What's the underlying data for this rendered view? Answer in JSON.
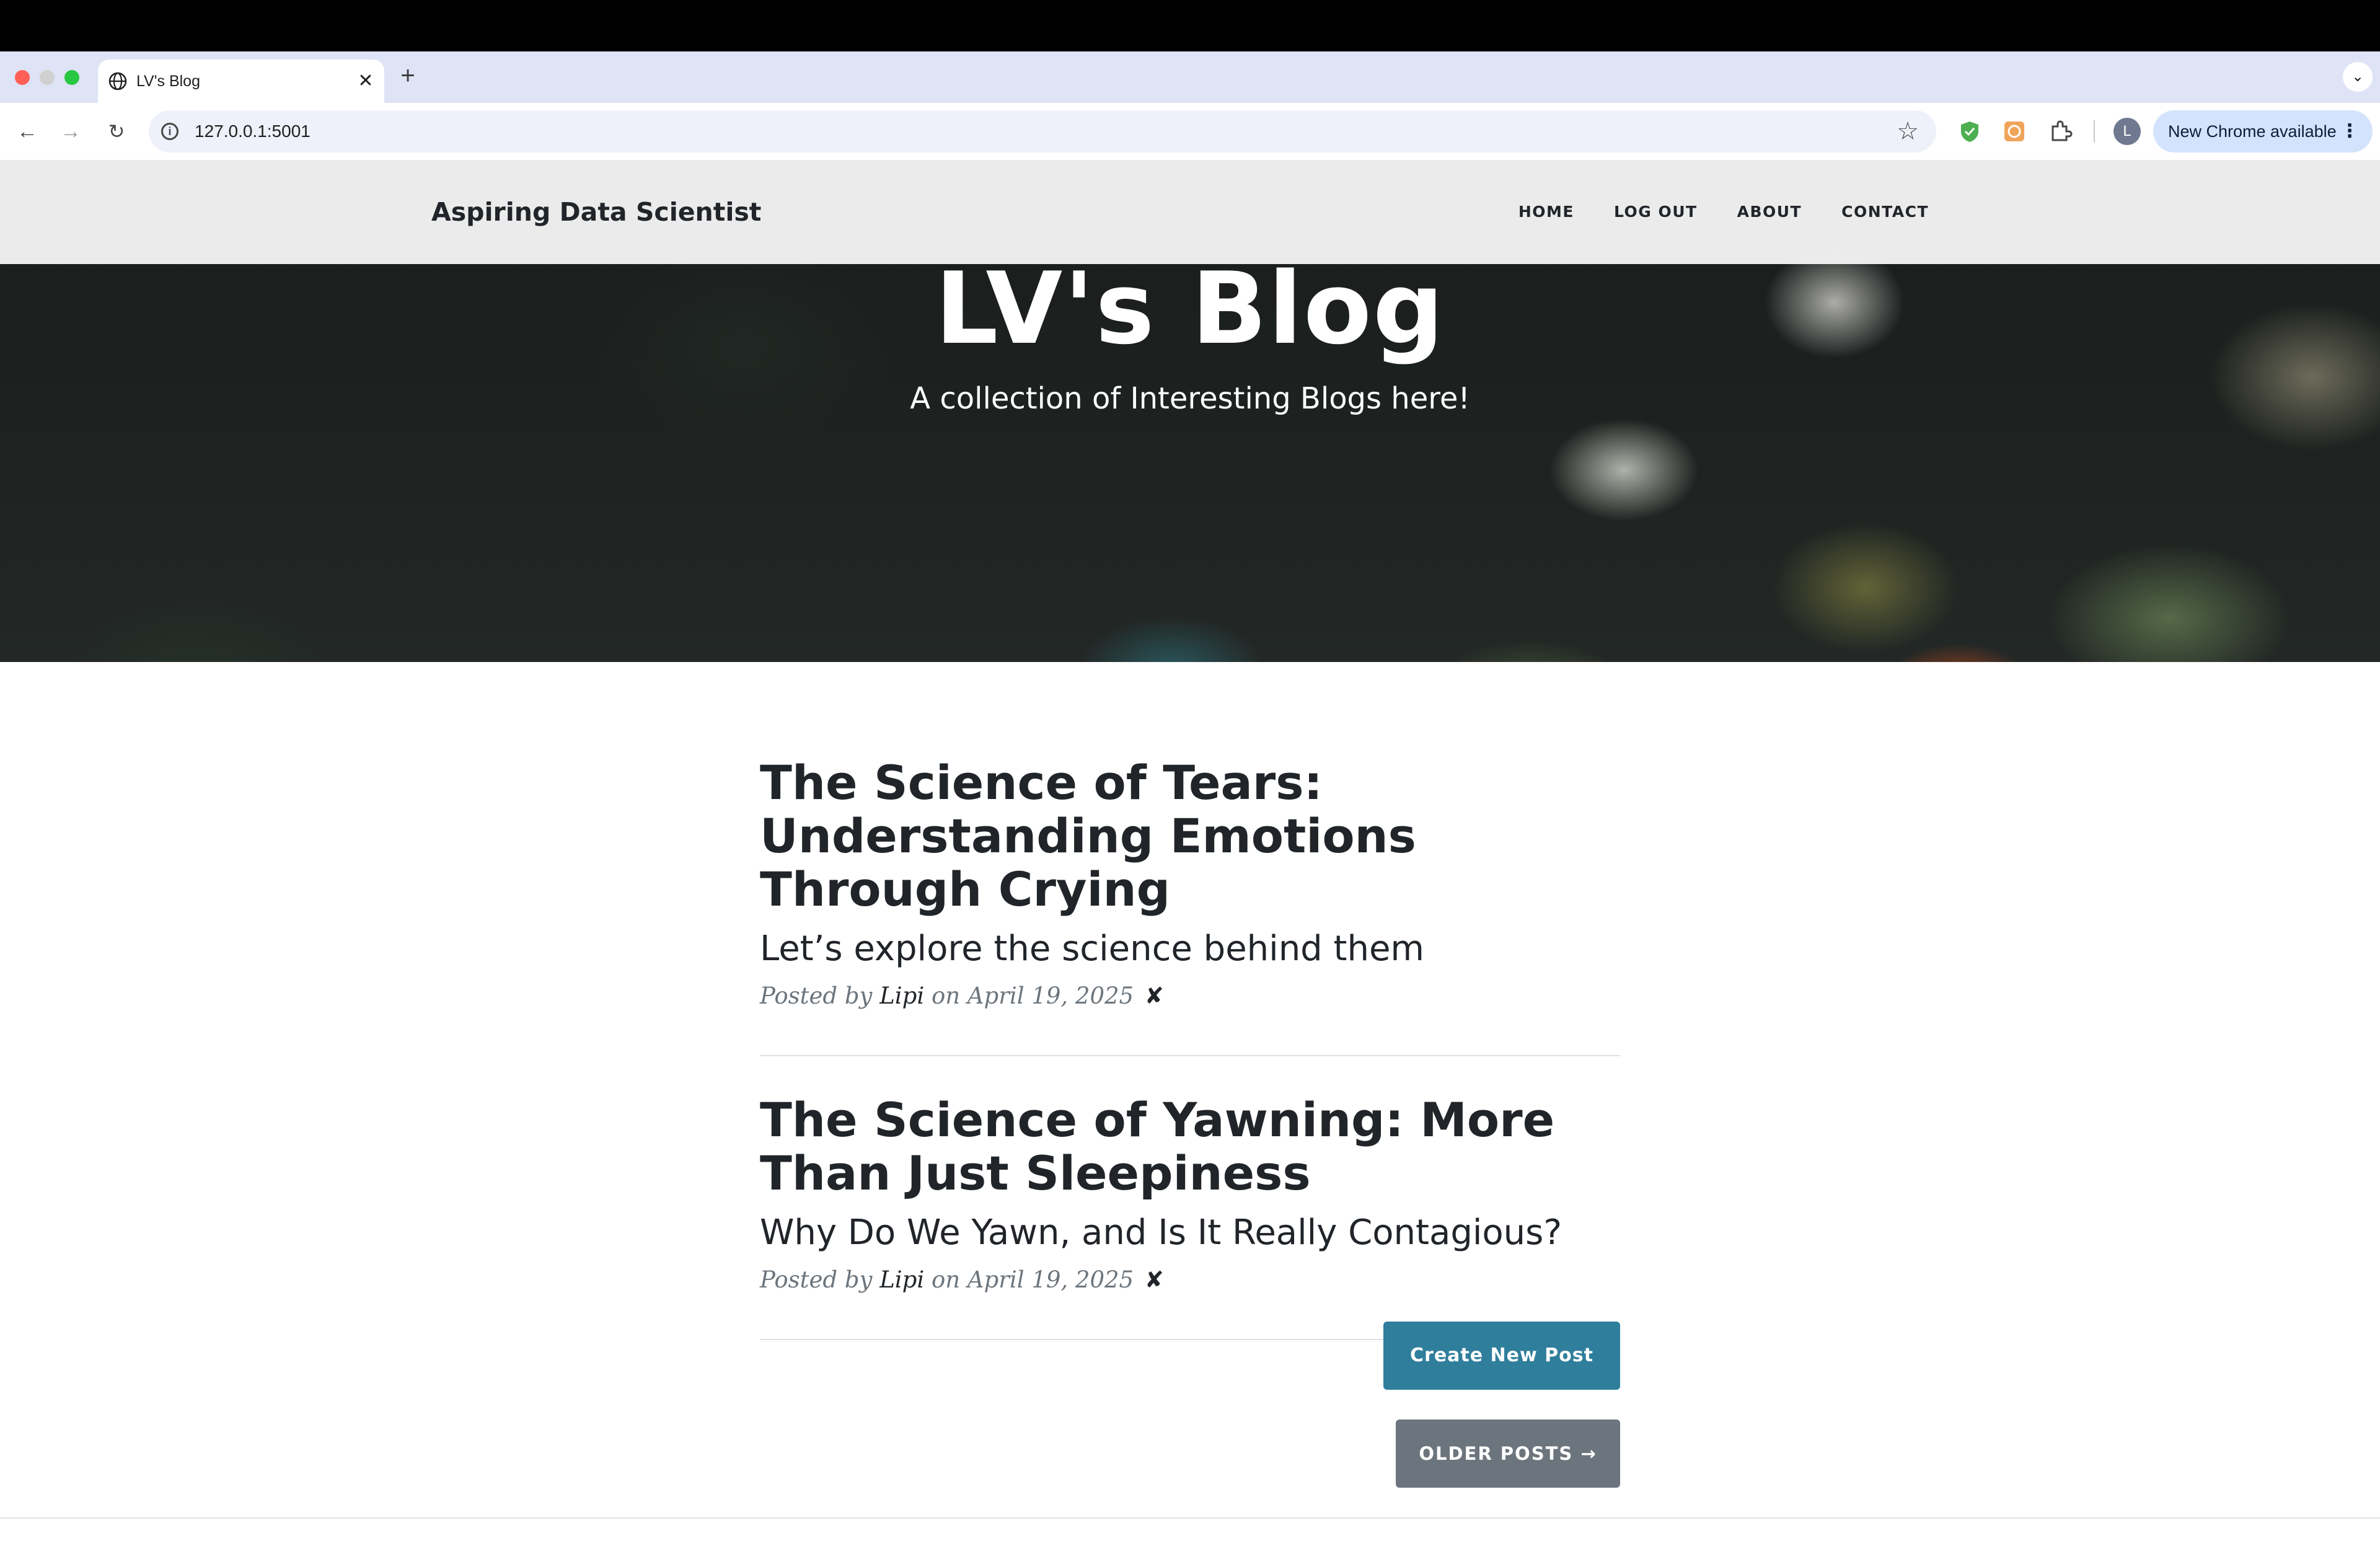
{
  "browser": {
    "tab_title": "LV's Blog",
    "tab_close": "✕",
    "new_tab": "+",
    "url": "127.0.0.1:5001",
    "profile_initial": "L",
    "update_label": "New Chrome available",
    "update_menu": "⋮"
  },
  "site": {
    "brand": "Aspiring Data Scientist",
    "nav": [
      "HOME",
      "LOG OUT",
      "ABOUT",
      "CONTACT"
    ],
    "hero_title": "LV's Blog",
    "hero_subtitle": "A collection of Interesting Blogs here!"
  },
  "posts": [
    {
      "title": "The Science of Tears: Understanding Emotions Through Crying",
      "subtitle": "Let’s explore the science behind them",
      "posted_by": "Posted by",
      "author": "Lipi",
      "on": "on April 19, 2025",
      "delete": "✘"
    },
    {
      "title": "The Science of Yawning: More Than Just Sleepiness",
      "subtitle": "Why Do We Yawn, and Is It Really Contagious?",
      "posted_by": "Posted by",
      "author": "Lipi",
      "on": "on April 19, 2025",
      "delete": "✘"
    }
  ],
  "actions": {
    "create": "Create New Post",
    "older": "OLDER POSTS →"
  },
  "colors": {
    "create_button": "#2f7e9c",
    "older_button": "#6c757d",
    "text": "#212529"
  }
}
